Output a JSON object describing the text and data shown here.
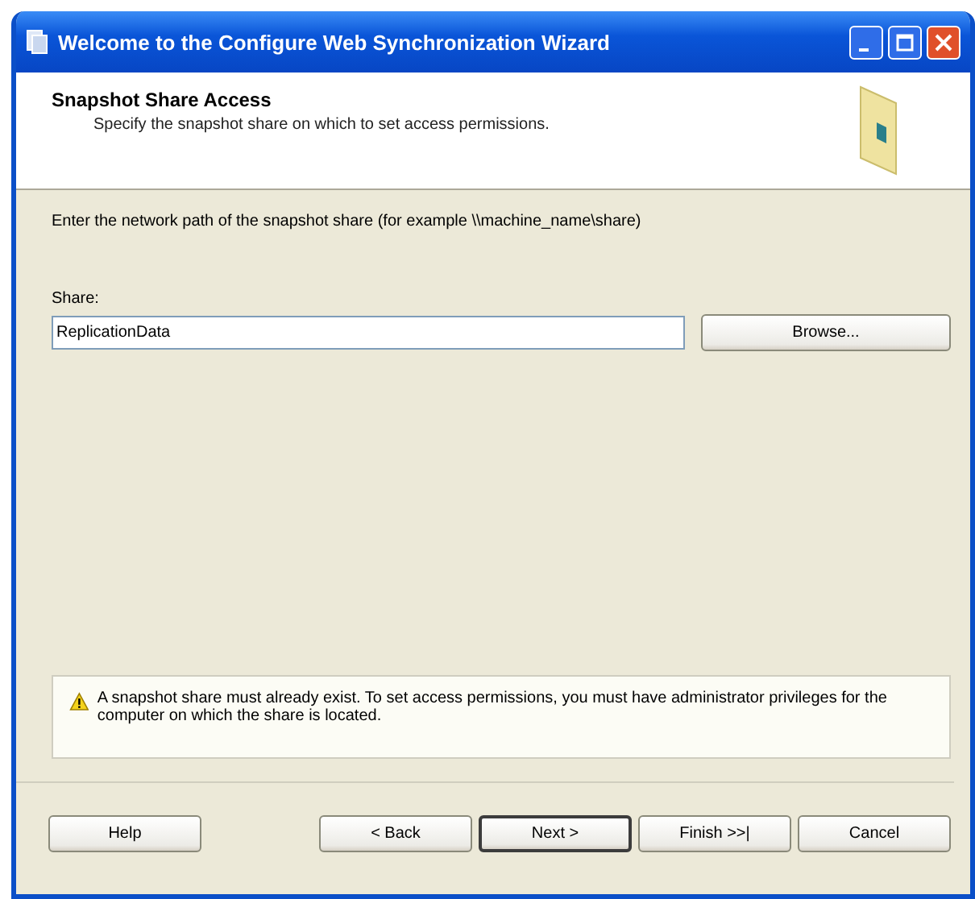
{
  "window": {
    "title": "Welcome to the Configure Web Synchronization Wizard"
  },
  "header": {
    "title": "Snapshot Share Access",
    "subtitle": "Specify the snapshot share on which to set access permissions."
  },
  "instruction": "Enter the network path of the snapshot share (for example \\\\machine_name\\share)",
  "share": {
    "label": "Share:",
    "value": "ReplicationData"
  },
  "browse_button": "Browse...",
  "warning": "A snapshot share must already exist. To set access permissions, you must have administrator privileges for the computer on which the share is located.",
  "buttons": [
    {
      "label": "Help",
      "default": false
    },
    {
      "label": "< Back",
      "default": false
    },
    {
      "label": "Next >",
      "default": true
    },
    {
      "label": "Finish >>|",
      "default": false
    },
    {
      "label": "Cancel",
      "default": false
    }
  ]
}
